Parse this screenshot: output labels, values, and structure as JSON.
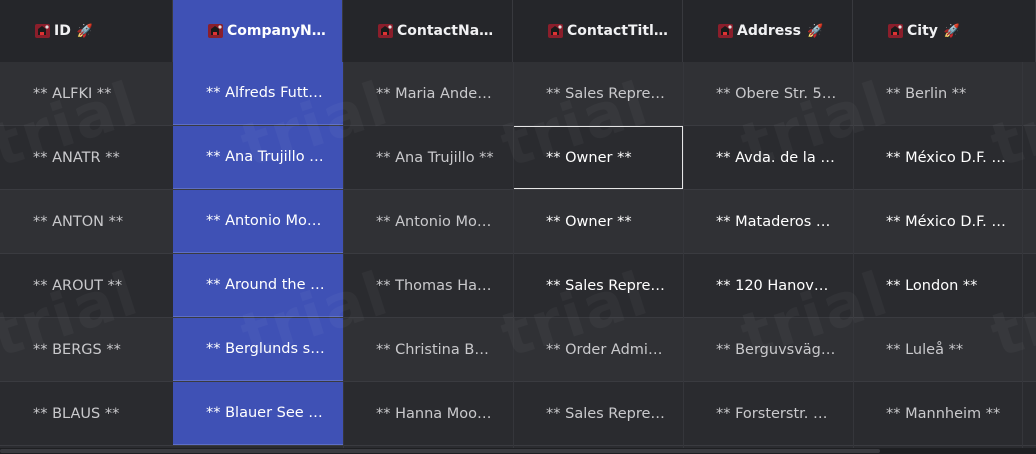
{
  "columns": [
    {
      "label": "ID",
      "icons": [
        "plant-icon",
        "rocket-icon"
      ],
      "selected": false
    },
    {
      "label": "CompanyN…",
      "icons": [
        "plant-icon"
      ],
      "selected": true
    },
    {
      "label": "ContactNa…",
      "icons": [
        "plant-icon"
      ],
      "selected": false
    },
    {
      "label": "ContactTitl…",
      "icons": [
        "plant-icon"
      ],
      "selected": false
    },
    {
      "label": "Address",
      "icons": [
        "plant-icon",
        "rocket-icon"
      ],
      "selected": false
    },
    {
      "label": "City",
      "icons": [
        "plant-icon",
        "rocket-icon"
      ],
      "selected": false
    }
  ],
  "rows": [
    [
      "** ALFKI **",
      "** Alfreds Futt…",
      "** Maria Ande…",
      "** Sales Repre…",
      "** Obere Str. 5…",
      "** Berlin **"
    ],
    [
      "** ANATR **",
      "** Ana Trujillo …",
      "** Ana Trujillo **",
      "** Owner **",
      "** Avda. de la …",
      "** México D.F. …"
    ],
    [
      "** ANTON **",
      "** Antonio Mo…",
      "** Antonio Mo…",
      "** Owner **",
      "** Mataderos …",
      "** México D.F. …"
    ],
    [
      "** AROUT **",
      "** Around the …",
      "** Thomas Ha…",
      "** Sales Repre…",
      "** 120 Hanov…",
      "** London **"
    ],
    [
      "** BERGS **",
      "** Berglunds s…",
      "** Christina B…",
      "** Order Admi…",
      "** Berguvsväg…",
      "** Luleå **"
    ],
    [
      "** BLAUS **",
      "** Blauer See …",
      "** Hanna Moo…",
      "** Sales Repre…",
      "** Forsterstr. …",
      "** Mannheim **"
    ]
  ],
  "focused_cell": {
    "row": 1,
    "col": 3
  },
  "watermark_text": "trial",
  "colors": {
    "selected_column": "#3f51b5",
    "background": "#2b2c30",
    "header": "#25262a"
  }
}
